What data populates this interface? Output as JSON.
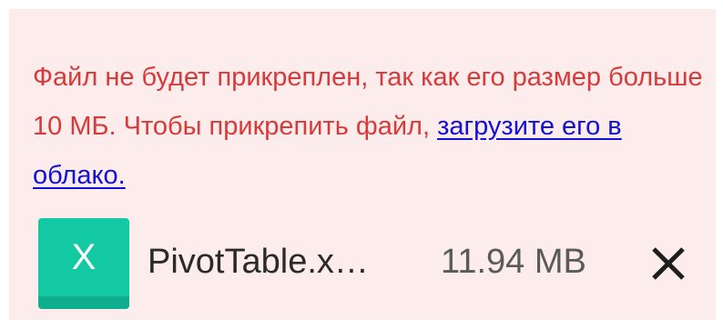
{
  "notice": {
    "text_before_link": "Файл не будет прикреплен, так как его размер больше 10 МБ. Чтобы прикрепить файл, ",
    "link_text": "загрузите его в облако."
  },
  "attachment": {
    "icon": "excel-file-icon",
    "icon_glyph": "X",
    "file_name": "PivotTable.x…",
    "file_size": "11.94 MB",
    "remove_icon": "close-icon"
  },
  "colors": {
    "background": "#fdecec",
    "warning_text": "#d83a3a",
    "link": "#1010d8",
    "file_icon": "#12c9a4"
  }
}
